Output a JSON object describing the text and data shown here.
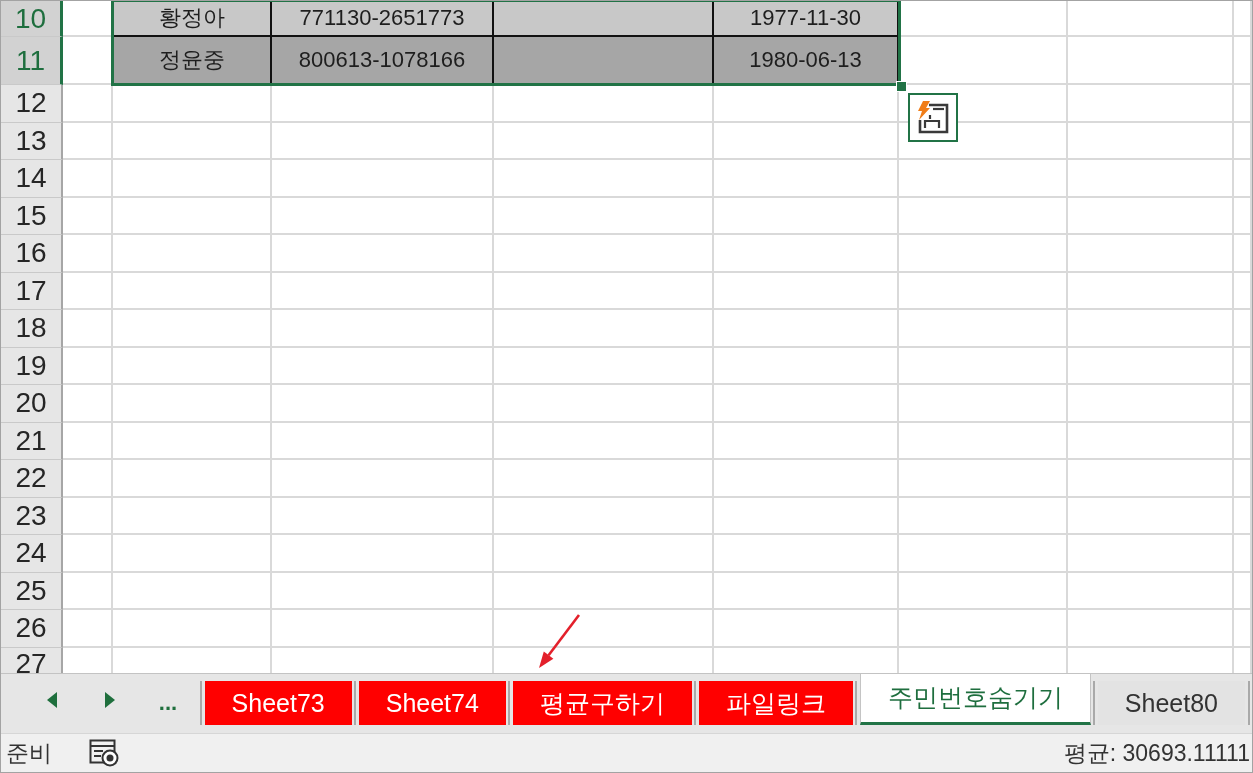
{
  "sheet": {
    "rows": [
      {
        "label": "10",
        "selected": true,
        "color": "#c8c8c8",
        "cells": [
          "황정아",
          "771130-2651773",
          null,
          "1977-11-30"
        ]
      },
      {
        "label": "11",
        "selected": true,
        "color": "#a6a6a6",
        "cells": [
          "정윤중",
          "800613-1078166",
          null,
          "1980-06-13"
        ]
      },
      {
        "label": "12",
        "selected": false
      },
      {
        "label": "13",
        "selected": false
      },
      {
        "label": "14",
        "selected": false
      },
      {
        "label": "15",
        "selected": false
      },
      {
        "label": "16",
        "selected": false
      },
      {
        "label": "17",
        "selected": false
      },
      {
        "label": "18",
        "selected": false
      },
      {
        "label": "19",
        "selected": false
      },
      {
        "label": "20",
        "selected": false
      },
      {
        "label": "21",
        "selected": false
      },
      {
        "label": "22",
        "selected": false
      },
      {
        "label": "23",
        "selected": false
      },
      {
        "label": "24",
        "selected": false
      },
      {
        "label": "25",
        "selected": false
      },
      {
        "label": "26",
        "selected": false
      },
      {
        "label": "27",
        "selected": false
      }
    ]
  },
  "sheet_tabs": {
    "more": "...",
    "tabs": [
      {
        "label": "Sheet73",
        "selected": false,
        "color": "#ff0000"
      },
      {
        "label": "Sheet74",
        "selected": false,
        "color": "#ff0000"
      },
      {
        "label": "평균구하기",
        "selected": false,
        "color": "#ff0000"
      },
      {
        "label": "파일링크",
        "selected": false,
        "color": "#ff0000"
      },
      {
        "label": "주민번호숨기기",
        "selected": true
      },
      {
        "label": "Sheet80",
        "selected": false
      }
    ]
  },
  "status_bar": {
    "mode": "준비",
    "summary": "평균: 30693.11111"
  },
  "annotations": [
    {
      "kind": "arrow"
    }
  ]
}
